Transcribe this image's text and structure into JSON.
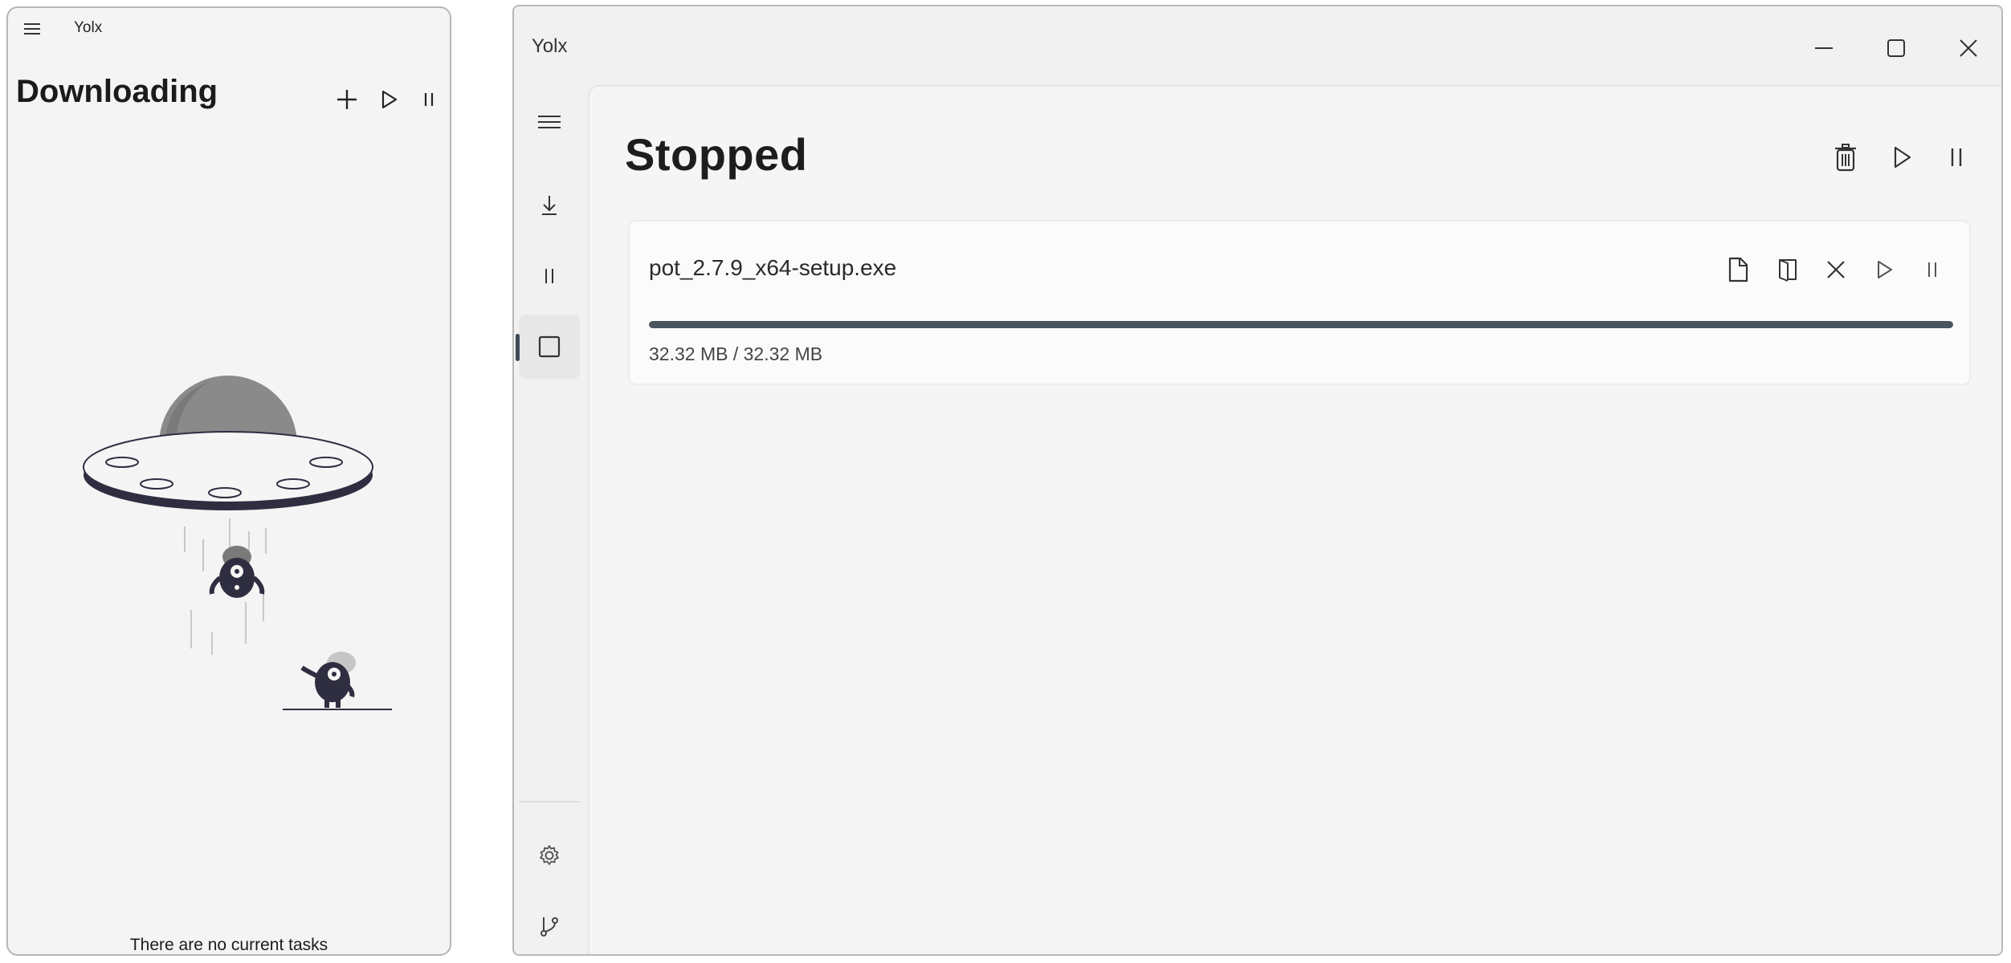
{
  "mobile": {
    "app_name": "Yolx",
    "title": "Downloading",
    "empty_message": "There are no current tasks",
    "icons": {
      "menu": "hamburger-icon",
      "add": "plus-icon",
      "play": "play-icon",
      "pause": "pause-icon",
      "illustration": "ufo-abduction-illustration"
    }
  },
  "desktop": {
    "app_name": "Yolx",
    "title": "Stopped",
    "window_controls": [
      "minimize-icon",
      "maximize-icon",
      "close-icon"
    ],
    "nav": {
      "items": [
        "hamburger-icon",
        "download-icon",
        "pause-icon",
        "stop-icon"
      ],
      "selected": "stop-icon",
      "footer": [
        "gear-icon",
        "git-branch-icon"
      ]
    },
    "header_actions": [
      "trash-icon",
      "play-icon",
      "pause-icon"
    ],
    "task": {
      "file_name": "pot_2.7.9_x64-setup.exe",
      "size_text": "32.32 MB / 32.32 MB",
      "progress_fraction": 1.0,
      "actions": [
        "file-icon",
        "open-folder-icon",
        "cancel-icon",
        "play-icon",
        "pause-icon"
      ]
    }
  },
  "colors": {
    "progress_fill": "#48545e",
    "accent_indicator": "#3d4a57",
    "illustration_dark": "#2f2e41",
    "illustration_gray": "#7a7a7a"
  }
}
